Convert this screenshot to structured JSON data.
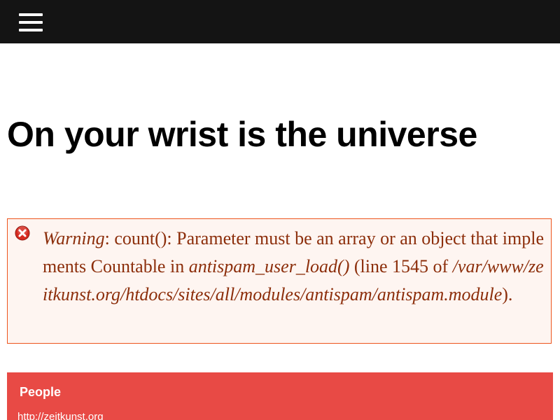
{
  "header": {
    "menu_icon": "hamburger-menu-icon",
    "background_color": "#141414"
  },
  "page": {
    "title": "On your wrist is the universe"
  },
  "error_message": {
    "icon": "error-x-icon",
    "label": "Warning",
    "message_part1": ": count(): Parameter must be an array or an object that implements Countable in ",
    "function": "antispam_user_load()",
    "message_part2": " (line 1545 of ",
    "file_path": "/var/www/zeitkunst.org/htdocs/sites/all/modules/antispam/antispam.module",
    "message_part3": ").",
    "text_color": "#8c2e0b",
    "border_color": "#ed541d",
    "background_color": "#fef5f1"
  },
  "people_block": {
    "title": "People",
    "link_text": "http://zeitkunst.org",
    "background_color": "#e84a45"
  }
}
